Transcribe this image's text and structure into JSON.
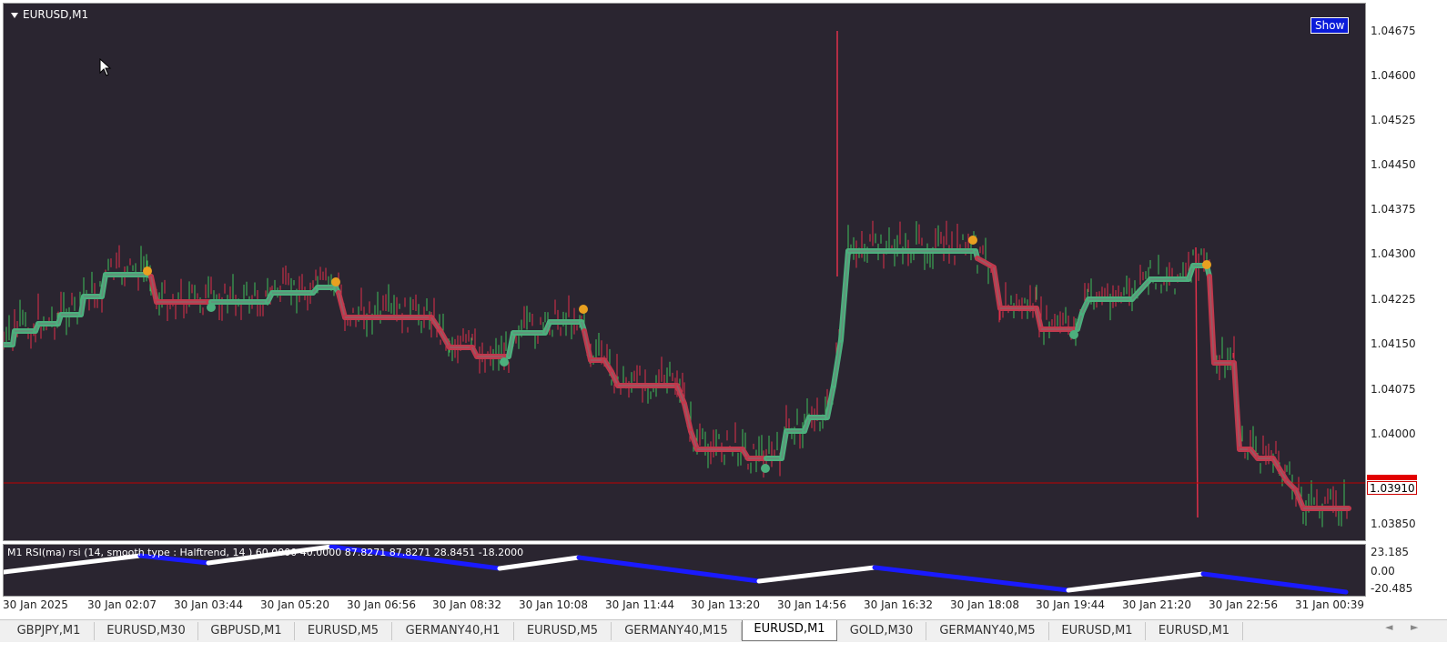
{
  "chart": {
    "title": "EURUSD,M1",
    "show_button": "Show",
    "current_price": "1.03910",
    "price_axis": [
      "1.04675",
      "1.04600",
      "1.04525",
      "1.04450",
      "1.04375",
      "1.04300",
      "1.04225",
      "1.04150",
      "1.04075",
      "1.04000",
      "1.03850"
    ],
    "colors": {
      "background": "#2a2530",
      "uptrend": "#4caf7d",
      "downtrend": "#c0394d",
      "candle_up": "#3fbf5a",
      "candle_down": "#e0304a",
      "arrow": "#e8a020",
      "current_price_line": "#c00000"
    }
  },
  "rsi": {
    "title": "M1 RSI(ma) rsi (14, smooth type : Halftrend, 14 ) 60.0000 40.0000 87.8271 87.8271 28.8451 -18.2000",
    "axis": [
      "23.185",
      "0.00",
      "-20.485"
    ],
    "colors": {
      "up": "#ffffff",
      "down": "#1a1aff"
    }
  },
  "time_axis": [
    "30 Jan 2025",
    "30 Jan 02:07",
    "30 Jan 03:44",
    "30 Jan 05:20",
    "30 Jan 06:56",
    "30 Jan 08:32",
    "30 Jan 10:08",
    "30 Jan 11:44",
    "30 Jan 13:20",
    "30 Jan 14:56",
    "30 Jan 16:32",
    "30 Jan 18:08",
    "30 Jan 19:44",
    "30 Jan 21:20",
    "30 Jan 22:56",
    "31 Jan 00:39"
  ],
  "tabs": [
    {
      "label": "GBPJPY,M1",
      "active": false
    },
    {
      "label": "EURUSD,M30",
      "active": false
    },
    {
      "label": "GBPUSD,M1",
      "active": false
    },
    {
      "label": "EURUSD,M5",
      "active": false
    },
    {
      "label": "GERMANY40,H1",
      "active": false
    },
    {
      "label": "EURUSD,M5",
      "active": false
    },
    {
      "label": "GERMANY40,M15",
      "active": false
    },
    {
      "label": "EURUSD,M1",
      "active": true
    },
    {
      "label": "GOLD,M30",
      "active": false
    },
    {
      "label": "GERMANY40,M5",
      "active": false
    },
    {
      "label": "EURUSD,M1",
      "active": false
    },
    {
      "label": "EURUSD,M1",
      "active": false
    }
  ],
  "nav": {
    "left": "◄",
    "right": "►"
  }
}
